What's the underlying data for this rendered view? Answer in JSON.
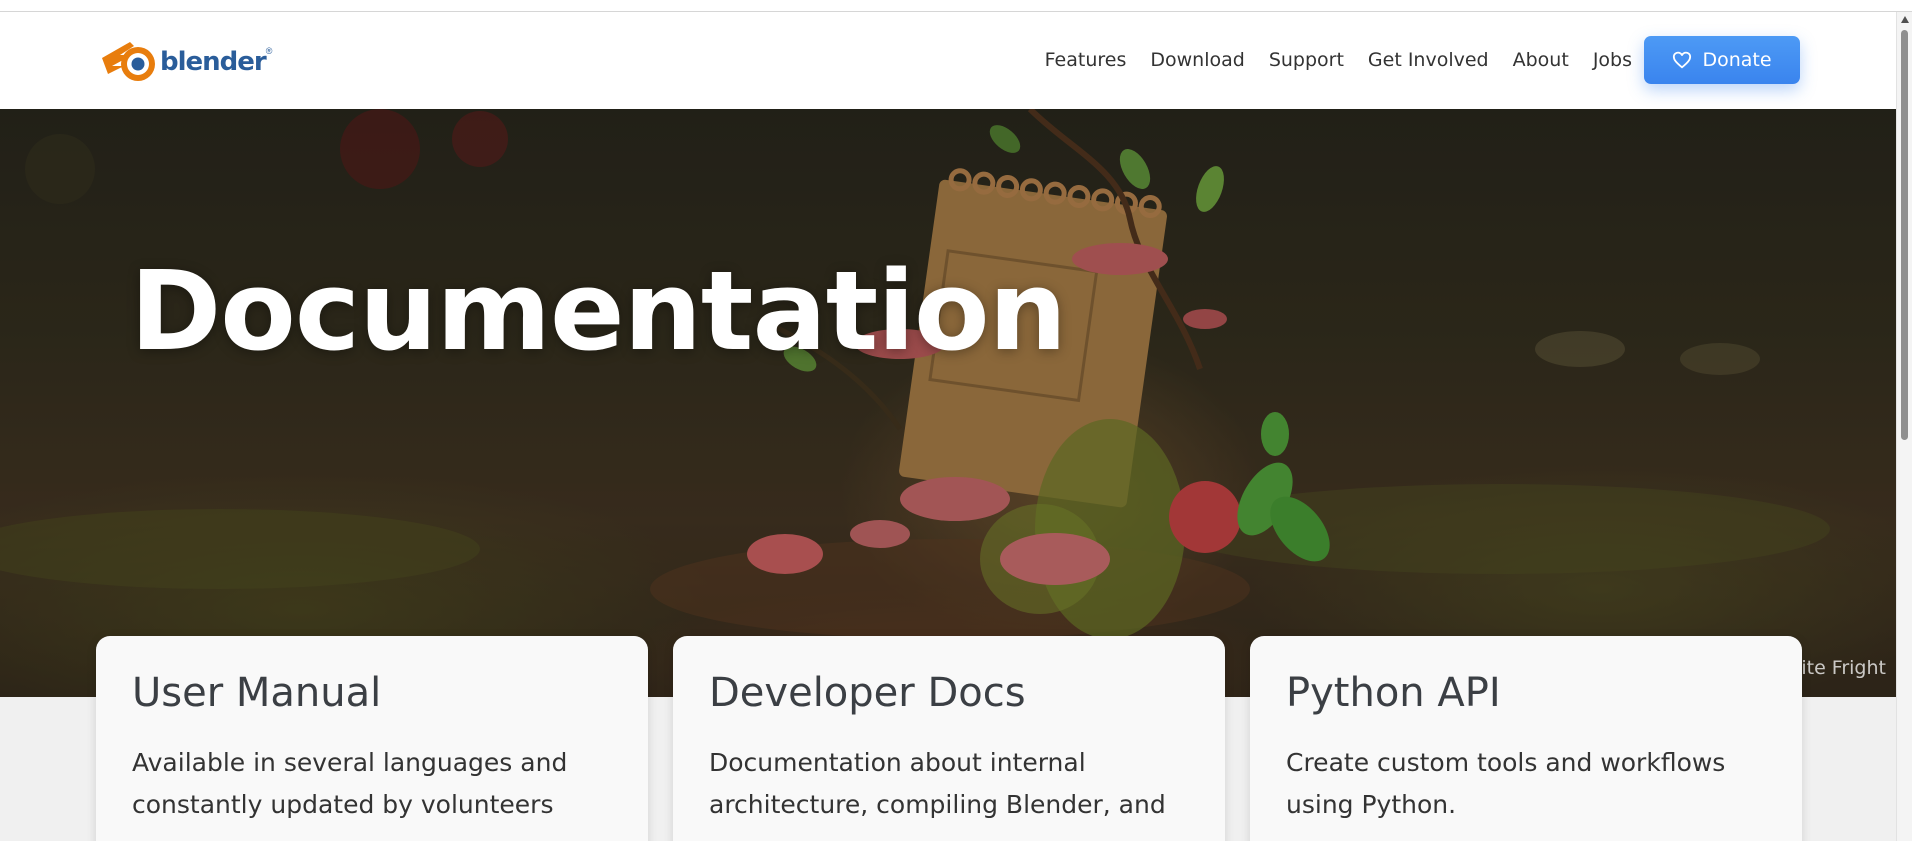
{
  "brand": {
    "logo_text": "blender",
    "trademark": "®"
  },
  "nav": {
    "links": [
      {
        "label": "Features"
      },
      {
        "label": "Download"
      },
      {
        "label": "Support"
      },
      {
        "label": "Get Involved"
      },
      {
        "label": "About"
      },
      {
        "label": "Jobs"
      }
    ],
    "donate_label": "Donate"
  },
  "hero": {
    "title": "Documentation",
    "credit": "Sprite Fright"
  },
  "cards": [
    {
      "title": "User Manual",
      "description": "Available in several languages and constantly updated by volunteers"
    },
    {
      "title": "Developer Docs",
      "description": "Documentation about internal architecture, compiling Blender, and"
    },
    {
      "title": "Python API",
      "description": "Create custom tools and workflows using Python."
    }
  ],
  "colors": {
    "accent": "#4d9af5",
    "logo_blue": "#2a5d9a",
    "logo_orange": "#e87d0d"
  }
}
